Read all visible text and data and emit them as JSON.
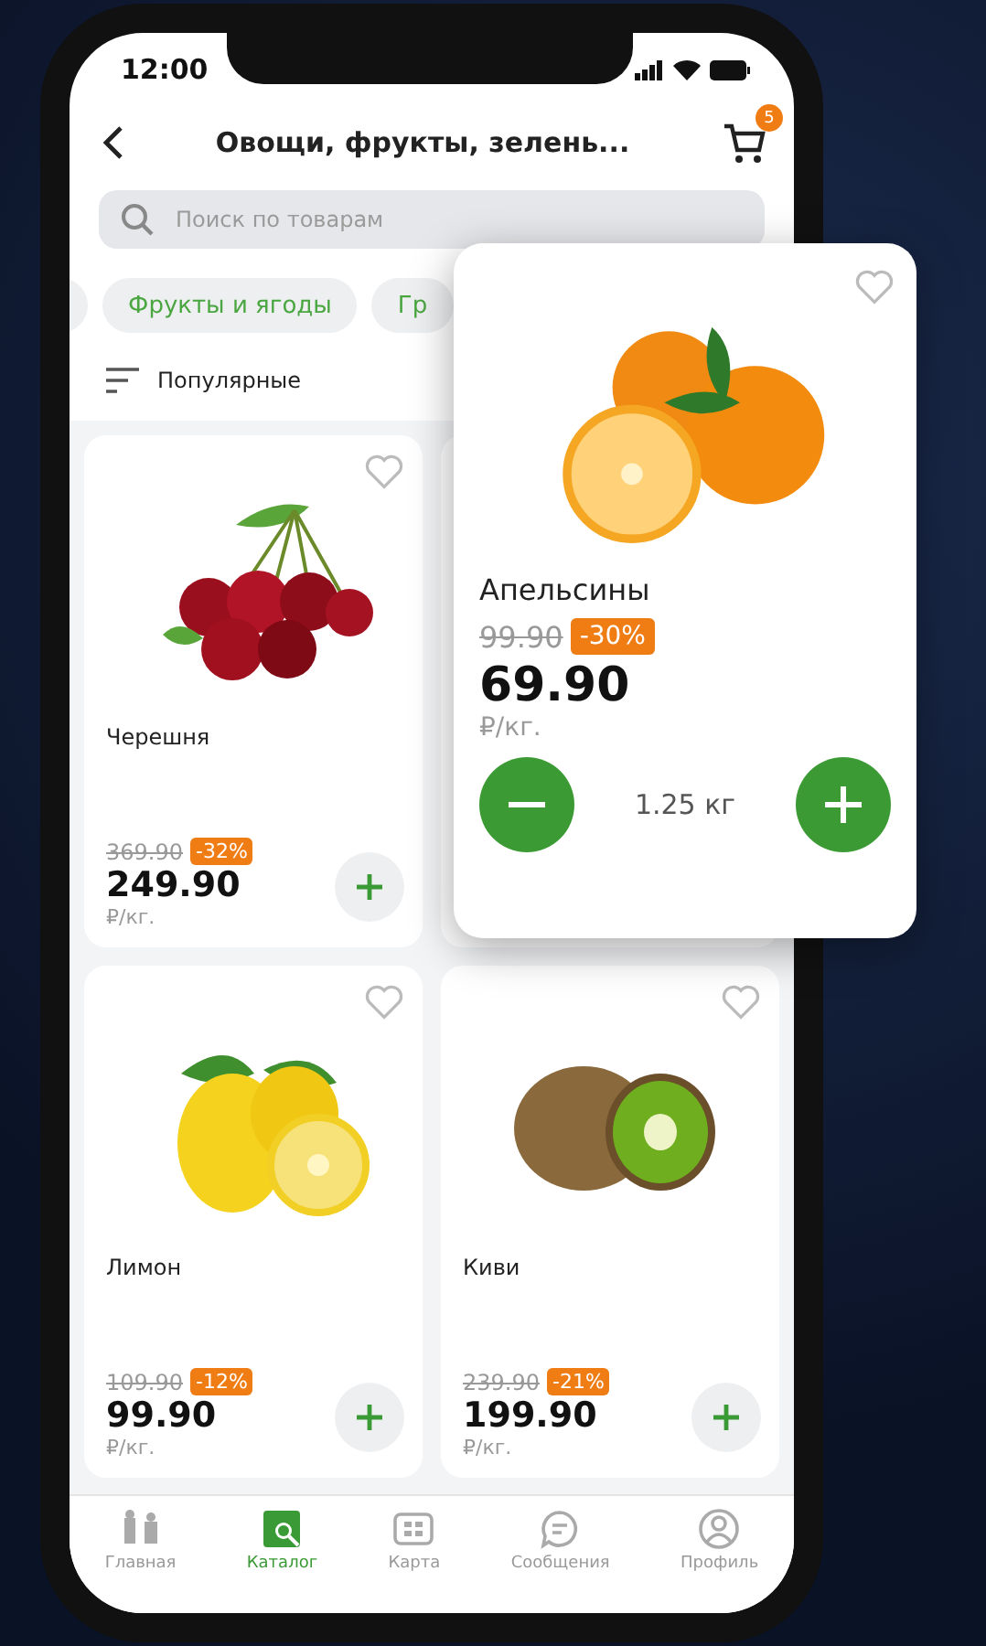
{
  "status_bar": {
    "time": "12:00"
  },
  "header": {
    "title": "Овощи, фрукты, зелень...",
    "cart_count": "5"
  },
  "search": {
    "placeholder": "Поиск по товарам"
  },
  "chips": [
    {
      "label": "Фрукты и ягоды"
    },
    {
      "label": "Гр"
    }
  ],
  "sort": {
    "label": "Популярные"
  },
  "products": [
    {
      "kind": "cherry",
      "name": "Черешня",
      "old_price": "369.90",
      "discount": "-32%",
      "price": "249.90",
      "unit": "₽/кг.",
      "favorite": false
    },
    {
      "kind": "lemon",
      "name": "Лимон",
      "old_price": "109.90",
      "discount": "-12%",
      "price": "99.90",
      "unit": "₽/кг.",
      "favorite": false
    },
    {
      "kind": "kiwi",
      "name": "Киви",
      "old_price": "239.90",
      "discount": "-21%",
      "price": "199.90",
      "unit": "₽/кг.",
      "favorite": false
    }
  ],
  "popup": {
    "kind": "orange",
    "name": "Апельсины",
    "old_price": "99.90",
    "discount": "-30%",
    "price": "69.90",
    "unit": "₽/кг.",
    "quantity": "1.25 кг",
    "favorite": false
  },
  "nav": [
    {
      "kind": "home",
      "label": "Главная",
      "selected": false
    },
    {
      "kind": "catalog",
      "label": "Каталог",
      "selected": true
    },
    {
      "kind": "map",
      "label": "Карта",
      "selected": false
    },
    {
      "kind": "chat",
      "label": "Сообщения",
      "selected": false
    },
    {
      "kind": "profile",
      "label": "Профиль",
      "selected": false
    }
  ]
}
